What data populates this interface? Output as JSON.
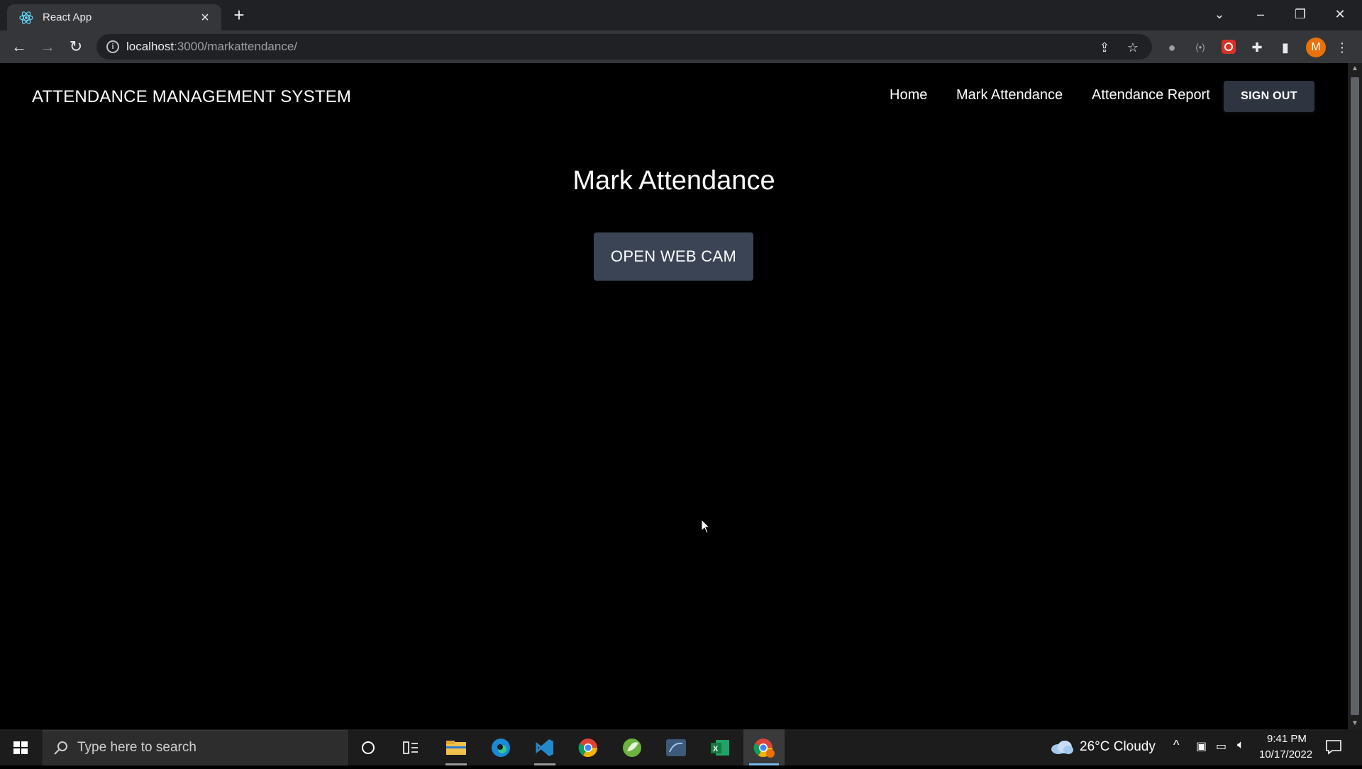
{
  "browser": {
    "tab_title": "React App",
    "url_host": "localhost",
    "url_path": ":3000/markattendance/",
    "profile_initial": "M"
  },
  "app": {
    "brand": "ATTENDANCE MANAGEMENT SYSTEM",
    "nav": {
      "home": "Home",
      "mark_attendance": "Mark Attendance",
      "attendance_report": "Attendance Report",
      "sign_out": "SIGN OUT"
    },
    "page_title": "Mark Attendance",
    "open_webcam": "OPEN WEB CAM"
  },
  "taskbar": {
    "search_placeholder": "Type here to search",
    "weather": "26°C  Cloudy",
    "time": "9:41 PM",
    "date": "10/17/2022"
  },
  "colors": {
    "page_bg": "#000000",
    "button_bg": "#3a4454",
    "signout_bg": "#2e3440",
    "profile_bg": "#e8710a"
  }
}
